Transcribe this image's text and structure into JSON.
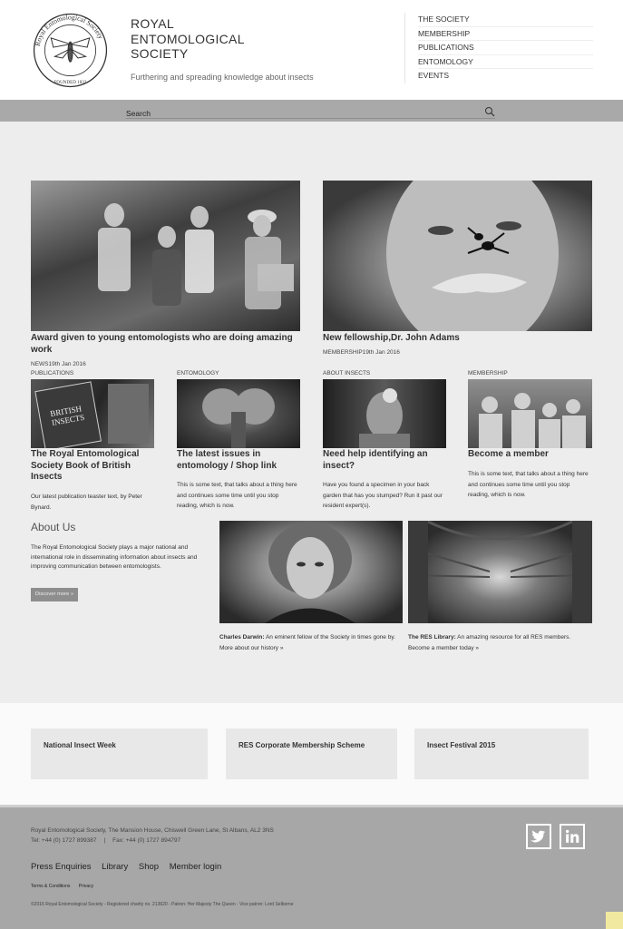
{
  "header": {
    "brand_lines": [
      "ROYAL",
      "ENTOMOLOGICAL",
      "SOCIETY"
    ],
    "tagline": "Furthering and spreading knowledge about insects",
    "logo": {
      "ring_text": "Royal Entomological Society",
      "founded": "FOUNDED 1833"
    },
    "nav": [
      "THE SOCIETY",
      "MEMBERSHIP",
      "PUBLICATIONS",
      "ENTOMOLOGY",
      "EVENTS"
    ]
  },
  "search": {
    "placeholder": "Search"
  },
  "features": [
    {
      "title": "Award given to young entomologists who are doing amazing work",
      "category": "NEWS",
      "date": "19th Jan 2016"
    },
    {
      "title": "New fellowship,Dr. John Adams",
      "category": "MEMBERSHIP",
      "date": "19th Jan 2016"
    }
  ],
  "cards": [
    {
      "category": "PUBLICATIONS",
      "title": "The Royal Entomological Society Book of British Insects",
      "text": "Our latest publication teaster text, by Peter Bynard."
    },
    {
      "category": "ENTOMOLOGY",
      "title": "The latest issues in entomology / Shop link",
      "text": "This is some text, that talks about a thing here and continues some time until you stop reading, which is now."
    },
    {
      "category": "ABOUT INSECTS",
      "title": "Need help identifying an insect?",
      "text": "Have you found a specimen in your back garden that has you stumped? Run it past our resident expert(s)."
    },
    {
      "category": "MEMBERSHIP",
      "title": "Become a member",
      "text": "This is some text, that talks about a thing here and continues some time until you stop reading, which is now."
    }
  ],
  "book_cover": [
    "BRITISH",
    "INSECTS"
  ],
  "about": {
    "title": "About Us",
    "text": "The Royal Entomological Society plays a major national and international role in disseminating information about insects and improving communication between entomologists.",
    "button": "Discover more »"
  },
  "captions": [
    {
      "bold": "Charles Darwin:",
      "text": " An eminent fellow of the Society in times gone by.",
      "link": " More about our history »"
    },
    {
      "bold": "The RES Library:",
      "text": " An amazing resource for all RES members.",
      "link": " Become a member today »"
    }
  ],
  "promos": [
    "National Insect Week",
    "RES Corporate Membership Scheme",
    "Insect Festival 2015"
  ],
  "footer": {
    "address": "Royal Entomological Society, The Mansion House, Chiswell Green Lane, St Albans, AL2 3NS",
    "phone": "Tel: +44 (0) 1727 899387",
    "separator": "|",
    "fax": "Fax: +44 (0) 1727 894797",
    "links": [
      "Press Enquiries",
      "Library",
      "Shop",
      "Member login"
    ],
    "legal": [
      "Terms & Conditions",
      "Privacy"
    ],
    "copyright": "©2016 Royal Entomological Society - Registered charity no. 213620 - Patron: Her Majesty The Queen - Vice patron: Lord Selborne"
  },
  "colors": {
    "header_bg": "#ffffff",
    "search_band": "#a9a9a9",
    "page_bg": "#ededed",
    "footer_bg": "#a7a7a7",
    "promo_bg": "#e8e8e8"
  }
}
